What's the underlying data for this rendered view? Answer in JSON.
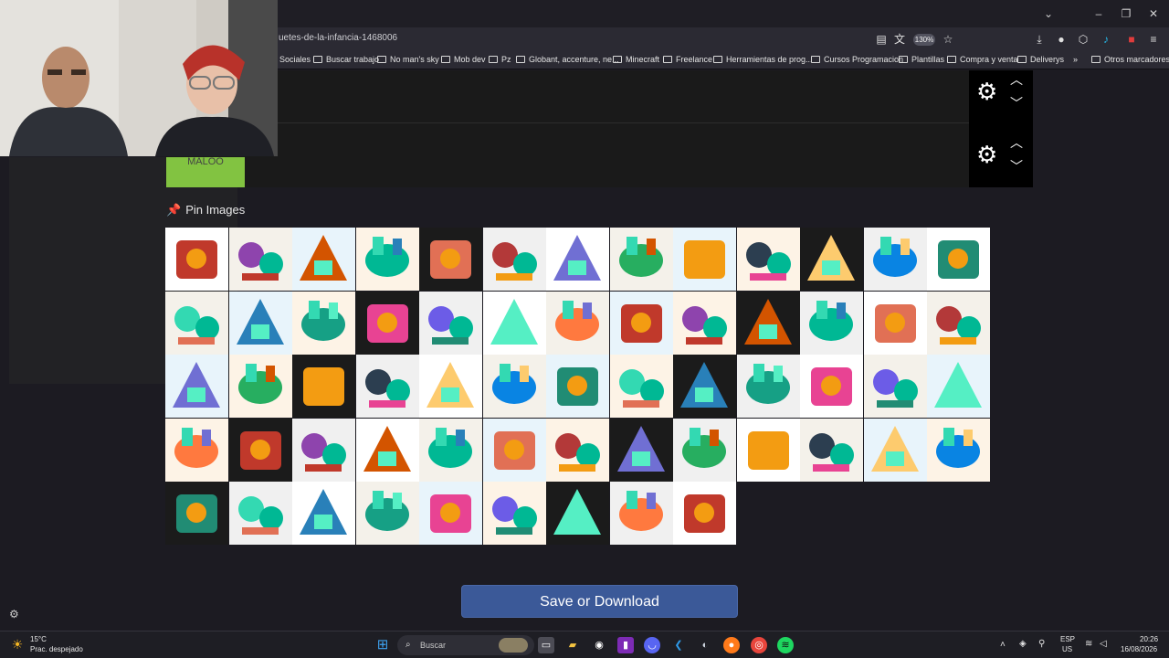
{
  "browser": {
    "url": "uetes-de-la-infancia-1468006",
    "zoom": "130%",
    "bookmarks": [
      "Sociales",
      "Buscar trabajo",
      "No man's sky",
      "Mob dev",
      "Pz",
      "Globant, accenture, ne...",
      "Minecraft",
      "Freelance",
      "Herramientas de prog...",
      "Cursos Programacion",
      "Plantillas",
      "Compra y venta",
      "Deliverys",
      "Otros marcadores"
    ]
  },
  "page": {
    "green_label": "MALOO",
    "pin_heading": "Pin Images",
    "save_button": "Save or Download",
    "image_grid_count": 61
  },
  "taskbar": {
    "weather_temp": "15°C",
    "weather_desc": "Prac. despejado",
    "search_label": "Buscar",
    "lang_1": "ESP",
    "lang_2": "US",
    "time": "20:26",
    "date": "16/08/2026"
  },
  "colors": {
    "accent_button": "#3b5998",
    "green_box": "#82c341",
    "pin": "#d94f6a"
  },
  "icons": [
    "gear-icon",
    "chevron-up-icon",
    "chevron-down-icon",
    "pin-icon",
    "windows-start-icon",
    "search-icon",
    "settings-icon"
  ]
}
